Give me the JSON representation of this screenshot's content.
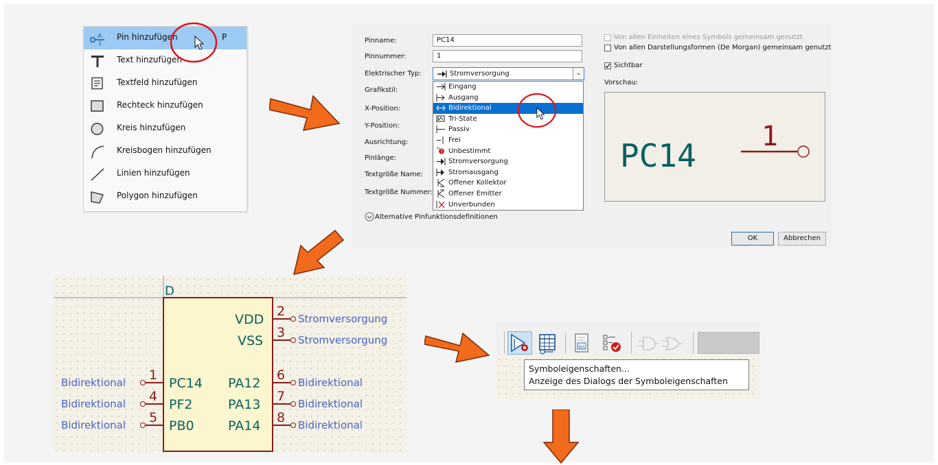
{
  "menu": {
    "items": [
      {
        "label": "Pin hinzufügen",
        "shortcut": "P",
        "icon": "pin-icon",
        "highlighted": true
      },
      {
        "label": "Text hinzufügen",
        "icon": "text-icon"
      },
      {
        "label": "Textfeld hinzufügen",
        "icon": "textbox-icon"
      },
      {
        "label": "Rechteck hinzufügen",
        "icon": "rectangle-icon"
      },
      {
        "label": "Kreis hinzufügen",
        "icon": "circle-icon"
      },
      {
        "label": "Kreisbogen hinzufügen",
        "icon": "arc-icon"
      },
      {
        "label": "Linien hinzufügen",
        "icon": "line-icon"
      },
      {
        "label": "Polygon hinzufügen",
        "icon": "polygon-icon"
      }
    ]
  },
  "dialog": {
    "fields": {
      "pinname_label": "Pinname:",
      "pinname_value": "PC14",
      "pinnummer_label": "Pinnummer:",
      "pinnummer_value": "1",
      "elektrischer_typ_label": "Elektrischer Typ:",
      "elektrischer_typ_value": "Stromversorgung",
      "grafikstil_label": "Grafikstil:",
      "x_position_label": "X-Position:",
      "y_position_label": "Y-Position:",
      "ausrichtung_label": "Ausrichtung:",
      "pinlaenge_label": "Pinlänge:",
      "textgroesse_name_label": "Textgröße Name:",
      "textgroesse_nummer_label": "Textgröße Nummer:"
    },
    "dropdown_options": [
      "Eingang",
      "Ausgang",
      "Bidirektional",
      "Tri-State",
      "Passiv",
      "Frei",
      "Unbestimmt",
      "Stromversorgung",
      "Stromausgang",
      "Offener Kollektor",
      "Offener Emitter",
      "Unverbunden"
    ],
    "selected_option": "Bidirektional",
    "checkboxes": {
      "shared_units": "Von allen Einheiten eines Symbols gemeinsam genutzt",
      "shared_demorgan": "Von allen Darstellungsformen (De Morgan) gemeinsam genutzt",
      "sichtbar": "Sichtbar"
    },
    "vorschau_label": "Vorschau:",
    "preview": {
      "pin_name": "PC14",
      "pin_number": "1"
    },
    "alternate_link": "Alternative Pinfunktionsdefinitionen",
    "ok_label": "OK",
    "cancel_label": "Abbrechen"
  },
  "schematic": {
    "ref": "D",
    "right_pins": [
      {
        "number": "2",
        "name": "VDD",
        "type": "Stromversorgung"
      },
      {
        "number": "3",
        "name": "VSS",
        "type": "Stromversorgung"
      },
      {
        "number": "6",
        "name": "PA12",
        "type": "Bidirektional"
      },
      {
        "number": "7",
        "name": "PA13",
        "type": "Bidirektional"
      },
      {
        "number": "8",
        "name": "PA14",
        "type": "Bidirektional"
      }
    ],
    "left_pins": [
      {
        "number": "1",
        "name": "PC14",
        "type": "Bidirektional"
      },
      {
        "number": "4",
        "name": "PF2",
        "type": "Bidirektional"
      },
      {
        "number": "5",
        "name": "PB0",
        "type": "Bidirektional"
      }
    ]
  },
  "toolbar": {
    "tooltip_title": "Symboleigenschaften...",
    "tooltip_desc": "Anzeige des Dialogs der Symboleigenschaften"
  },
  "colors": {
    "arrow": "#f26a1b",
    "highlight_circle": "#e0121a",
    "pin_line": "#8a1a1a",
    "pin_name_text": "#0a6060",
    "pin_type_text": "#4a63c8",
    "symbol_fill": "#fbf6cd",
    "menu_highlight": "#9ccaf2",
    "dropdown_selection": "#0a6fd1"
  }
}
